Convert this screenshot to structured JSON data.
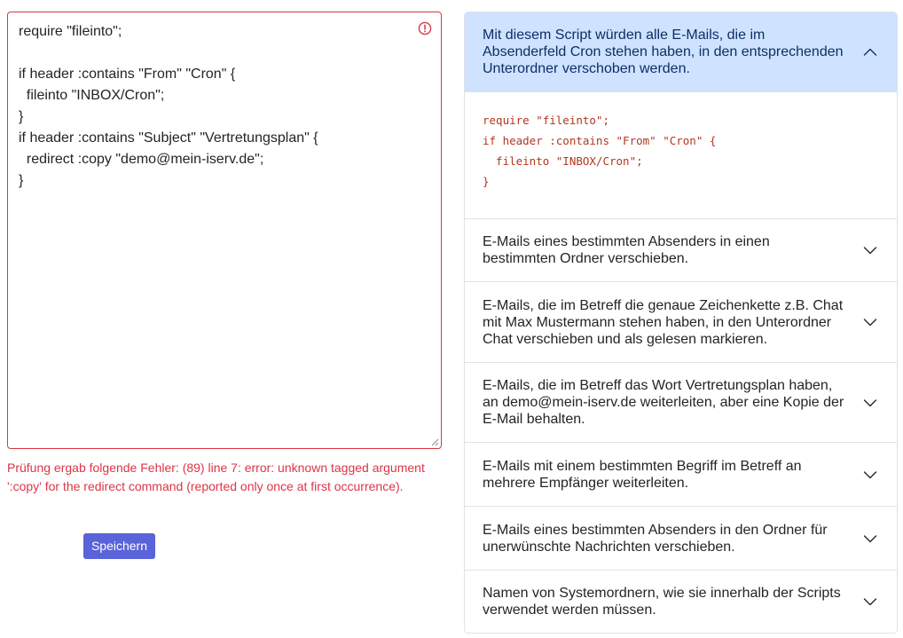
{
  "editor": {
    "content": "require \"fileinto\";\n\nif header :contains \"From\" \"Cron\" {\n  fileinto \"INBOX/Cron\";\n}\nif header :contains \"Subject\" \"Vertretungsplan\" {\n  redirect :copy \"demo@mein-iserv.de\";\n}",
    "error_icon": "exclamation-circle-icon"
  },
  "error_message": "Prüfung ergab folgende Fehler: (89) line 7: error: unknown tagged argument ':copy' for the redirect command (reported only once at first occurrence).",
  "save_label": "Speichern",
  "colors": {
    "error": "#dc3545",
    "primary_button": "#5a63d8",
    "accordion_open_bg": "#cfe2ff",
    "code": "#b3361f"
  },
  "accordion": {
    "items": [
      {
        "title": "Mit diesem Script würden alle E-Mails, die im Absenderfeld Cron stehen haben, in den entsprechenden Unterordner verschoben werden.",
        "expanded": true,
        "icon": "chevron-up-icon",
        "code": "require \"fileinto\";\nif header :contains \"From\" \"Cron\" {\n  fileinto \"INBOX/Cron\";\n}"
      },
      {
        "title": "E-Mails eines bestimmten Absenders in einen bestimmten Ordner verschieben.",
        "expanded": false,
        "icon": "chevron-down-icon"
      },
      {
        "title": "E-Mails, die im Betreff die genaue Zeichenkette z.B. Chat mit Max Mustermann stehen haben, in den Unterordner Chat verschieben und als gelesen markieren.",
        "expanded": false,
        "icon": "chevron-down-icon"
      },
      {
        "title": "E-Mails, die im Betreff das Wort Vertretungsplan haben, an demo@mein-iserv.de weiterleiten, aber eine Kopie der E-Mail behalten.",
        "expanded": false,
        "icon": "chevron-down-icon"
      },
      {
        "title": "E-Mails mit einem bestimmten Begriff im Betreff an mehrere Empfänger weiterleiten.",
        "expanded": false,
        "icon": "chevron-down-icon"
      },
      {
        "title": "E-Mails eines bestimmten Absenders in den Ordner für unerwünschte Nachrichten verschieben.",
        "expanded": false,
        "icon": "chevron-down-icon"
      },
      {
        "title": "Namen von Systemordnern, wie sie innerhalb der Scripts verwendet werden müssen.",
        "expanded": false,
        "icon": "chevron-down-icon"
      }
    ]
  }
}
